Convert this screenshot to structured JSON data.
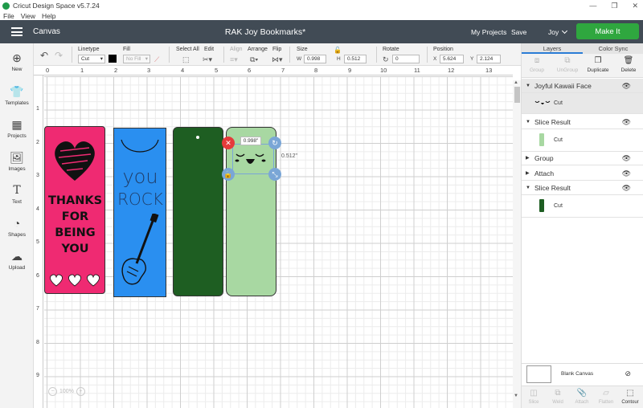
{
  "window": {
    "title": "Cricut Design Space  v5.7.24",
    "minimize": "—",
    "maximize": "❐",
    "close": "✕"
  },
  "menu": [
    "File",
    "View",
    "Help"
  ],
  "header": {
    "canvas_label": "Canvas",
    "project_title": "RAK Joy Bookmarks*",
    "my_projects": "My Projects",
    "save": "Save",
    "user": "Joy",
    "make_it": "Make It",
    "colors": {
      "header_bg": "#414b55",
      "make_it_bg": "#2fa73f"
    }
  },
  "toolbar": {
    "undo_icon": "undo-icon",
    "redo_icon": "redo-icon",
    "linetype": {
      "label": "Linetype",
      "value": "Cut"
    },
    "fill": {
      "label": "Fill",
      "value": "No Fill"
    },
    "select_all": {
      "label": "Select All"
    },
    "edit": {
      "label": "Edit"
    },
    "align": {
      "label": "Align"
    },
    "arrange": {
      "label": "Arrange"
    },
    "flip": {
      "label": "Flip"
    },
    "size": {
      "label": "Size",
      "w_label": "W",
      "w": "0.998",
      "h_label": "H",
      "h": "0.512"
    },
    "rotate": {
      "label": "Rotate",
      "value": "0"
    },
    "position": {
      "label": "Position",
      "x_label": "X",
      "x": "5.624",
      "y_label": "Y",
      "y": "2.124"
    }
  },
  "sidebar": [
    {
      "label": "New",
      "icon": "plus-icon"
    },
    {
      "label": "Templates",
      "icon": "shirt-icon"
    },
    {
      "label": "Projects",
      "icon": "projects-icon"
    },
    {
      "label": "Images",
      "icon": "images-icon"
    },
    {
      "label": "Text",
      "icon": "text-icon"
    },
    {
      "label": "Shapes",
      "icon": "shapes-icon"
    },
    {
      "label": "Upload",
      "icon": "upload-icon"
    }
  ],
  "ruler": {
    "top": [
      "0",
      "1",
      "2",
      "3",
      "4",
      "5",
      "6",
      "7",
      "8",
      "9",
      "10",
      "11",
      "12",
      "13"
    ],
    "left": [
      "1",
      "2",
      "3",
      "4",
      "5",
      "6",
      "7",
      "8",
      "9"
    ]
  },
  "canvas": {
    "zoom": "100%",
    "dim_width": "0.998\"",
    "dim_height": "0.512\"",
    "bookmark1": {
      "lines": [
        "THANKS",
        "FOR",
        "BEING",
        "YOU"
      ],
      "color": "#ef2a72"
    },
    "bookmark2": {
      "lines": [
        "you",
        "ROCK"
      ],
      "color": "#2a8ff0"
    },
    "bookmark3": {
      "color": "#1e5e22"
    },
    "bookmark4": {
      "color": "#a8d8a2"
    }
  },
  "layers_panel": {
    "tabs": [
      "Layers",
      "Color Sync"
    ],
    "actions": [
      {
        "label": "Group",
        "enabled": false
      },
      {
        "label": "UnGroup",
        "enabled": false
      },
      {
        "label": "Duplicate",
        "enabled": true
      },
      {
        "label": "Delete",
        "enabled": true
      }
    ],
    "layers": [
      {
        "name": "Joyful Kawaii Face",
        "sub": "Cut",
        "swatch": "face"
      },
      {
        "name": "Slice Result",
        "sub": "Cut",
        "swatch": "#a8d8a2"
      },
      {
        "name": "Group"
      },
      {
        "name": "Attach"
      },
      {
        "name": "Slice Result",
        "sub": "Cut",
        "swatch": "#1e5e22"
      }
    ],
    "blank_canvas": "Blank Canvas",
    "bottom": [
      {
        "label": "Slice",
        "enabled": false
      },
      {
        "label": "Weld",
        "enabled": false
      },
      {
        "label": "Attach",
        "enabled": false
      },
      {
        "label": "Flatten",
        "enabled": false
      },
      {
        "label": "Contour",
        "enabled": true
      }
    ]
  }
}
